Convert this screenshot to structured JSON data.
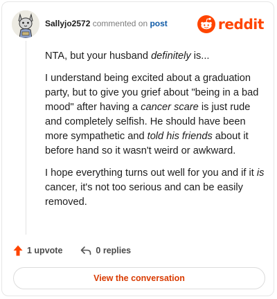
{
  "header": {
    "username": "Sallyjo2572",
    "verb": "commented on",
    "post_link": "post",
    "brand": "reddit"
  },
  "body": {
    "p1_pre": "NTA, but your husband ",
    "p1_em": "definitely",
    "p1_post": " is...",
    "p2_a": "I understand being excited about a graduation party, but to give you grief about \"being in a bad mood\" after having a ",
    "p2_em1": "cancer scare",
    "p2_b": " is just rude and completely selfish. He should have been more sympathetic and ",
    "p2_em2": "told his friends",
    "p2_c": " about it before hand so it wasn't weird or awkward.",
    "p3_a": "I hope everything turns out well for you and if it ",
    "p3_em": "is",
    "p3_b": " cancer, it's not too serious and can be easily removed."
  },
  "footer": {
    "upvotes": "1 upvote",
    "replies": "0 replies"
  },
  "cta": {
    "label": "View the conversation"
  },
  "colors": {
    "brand": "#ff4500",
    "link": "#0e5aa7",
    "cta_text": "#d93a00"
  },
  "icons": {
    "avatar": "avatar",
    "brand": "reddit-logo-icon",
    "upvote": "upvote-arrow-icon",
    "reply": "reply-arrow-icon"
  }
}
